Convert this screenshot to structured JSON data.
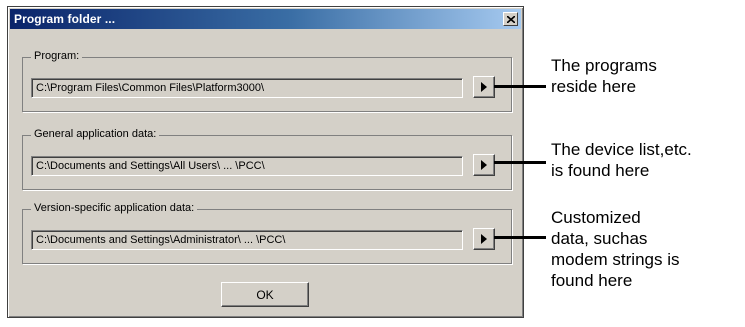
{
  "dialog": {
    "title": "Program folder ...",
    "close_icon": "close-icon",
    "ok_label": "OK"
  },
  "groups": [
    {
      "label": "Program:",
      "path": "C:\\Program Files\\Common Files\\Platform3000\\",
      "button_icon": "arrow-right-icon"
    },
    {
      "label": "General application data:",
      "path": "C:\\Documents and Settings\\All Users\\ ... \\PCC\\",
      "button_icon": "arrow-right-icon"
    },
    {
      "label": "Version-specific application data:",
      "path": "C:\\Documents and Settings\\Administrator\\ ... \\PCC\\",
      "button_icon": "arrow-right-icon"
    }
  ],
  "callouts": [
    {
      "line1": "The programs",
      "line2": "reside here"
    },
    {
      "line1": "The device list,etc.",
      "line2": "is found here"
    },
    {
      "line1": "Customized",
      "line2": "data, suchas",
      "line3": "modem strings is",
      "line4": "found here"
    }
  ],
  "colors": {
    "title_bar_start": "#0a246a",
    "title_bar_end": "#a6caf0",
    "dialog_face": "#d4d0c8"
  }
}
